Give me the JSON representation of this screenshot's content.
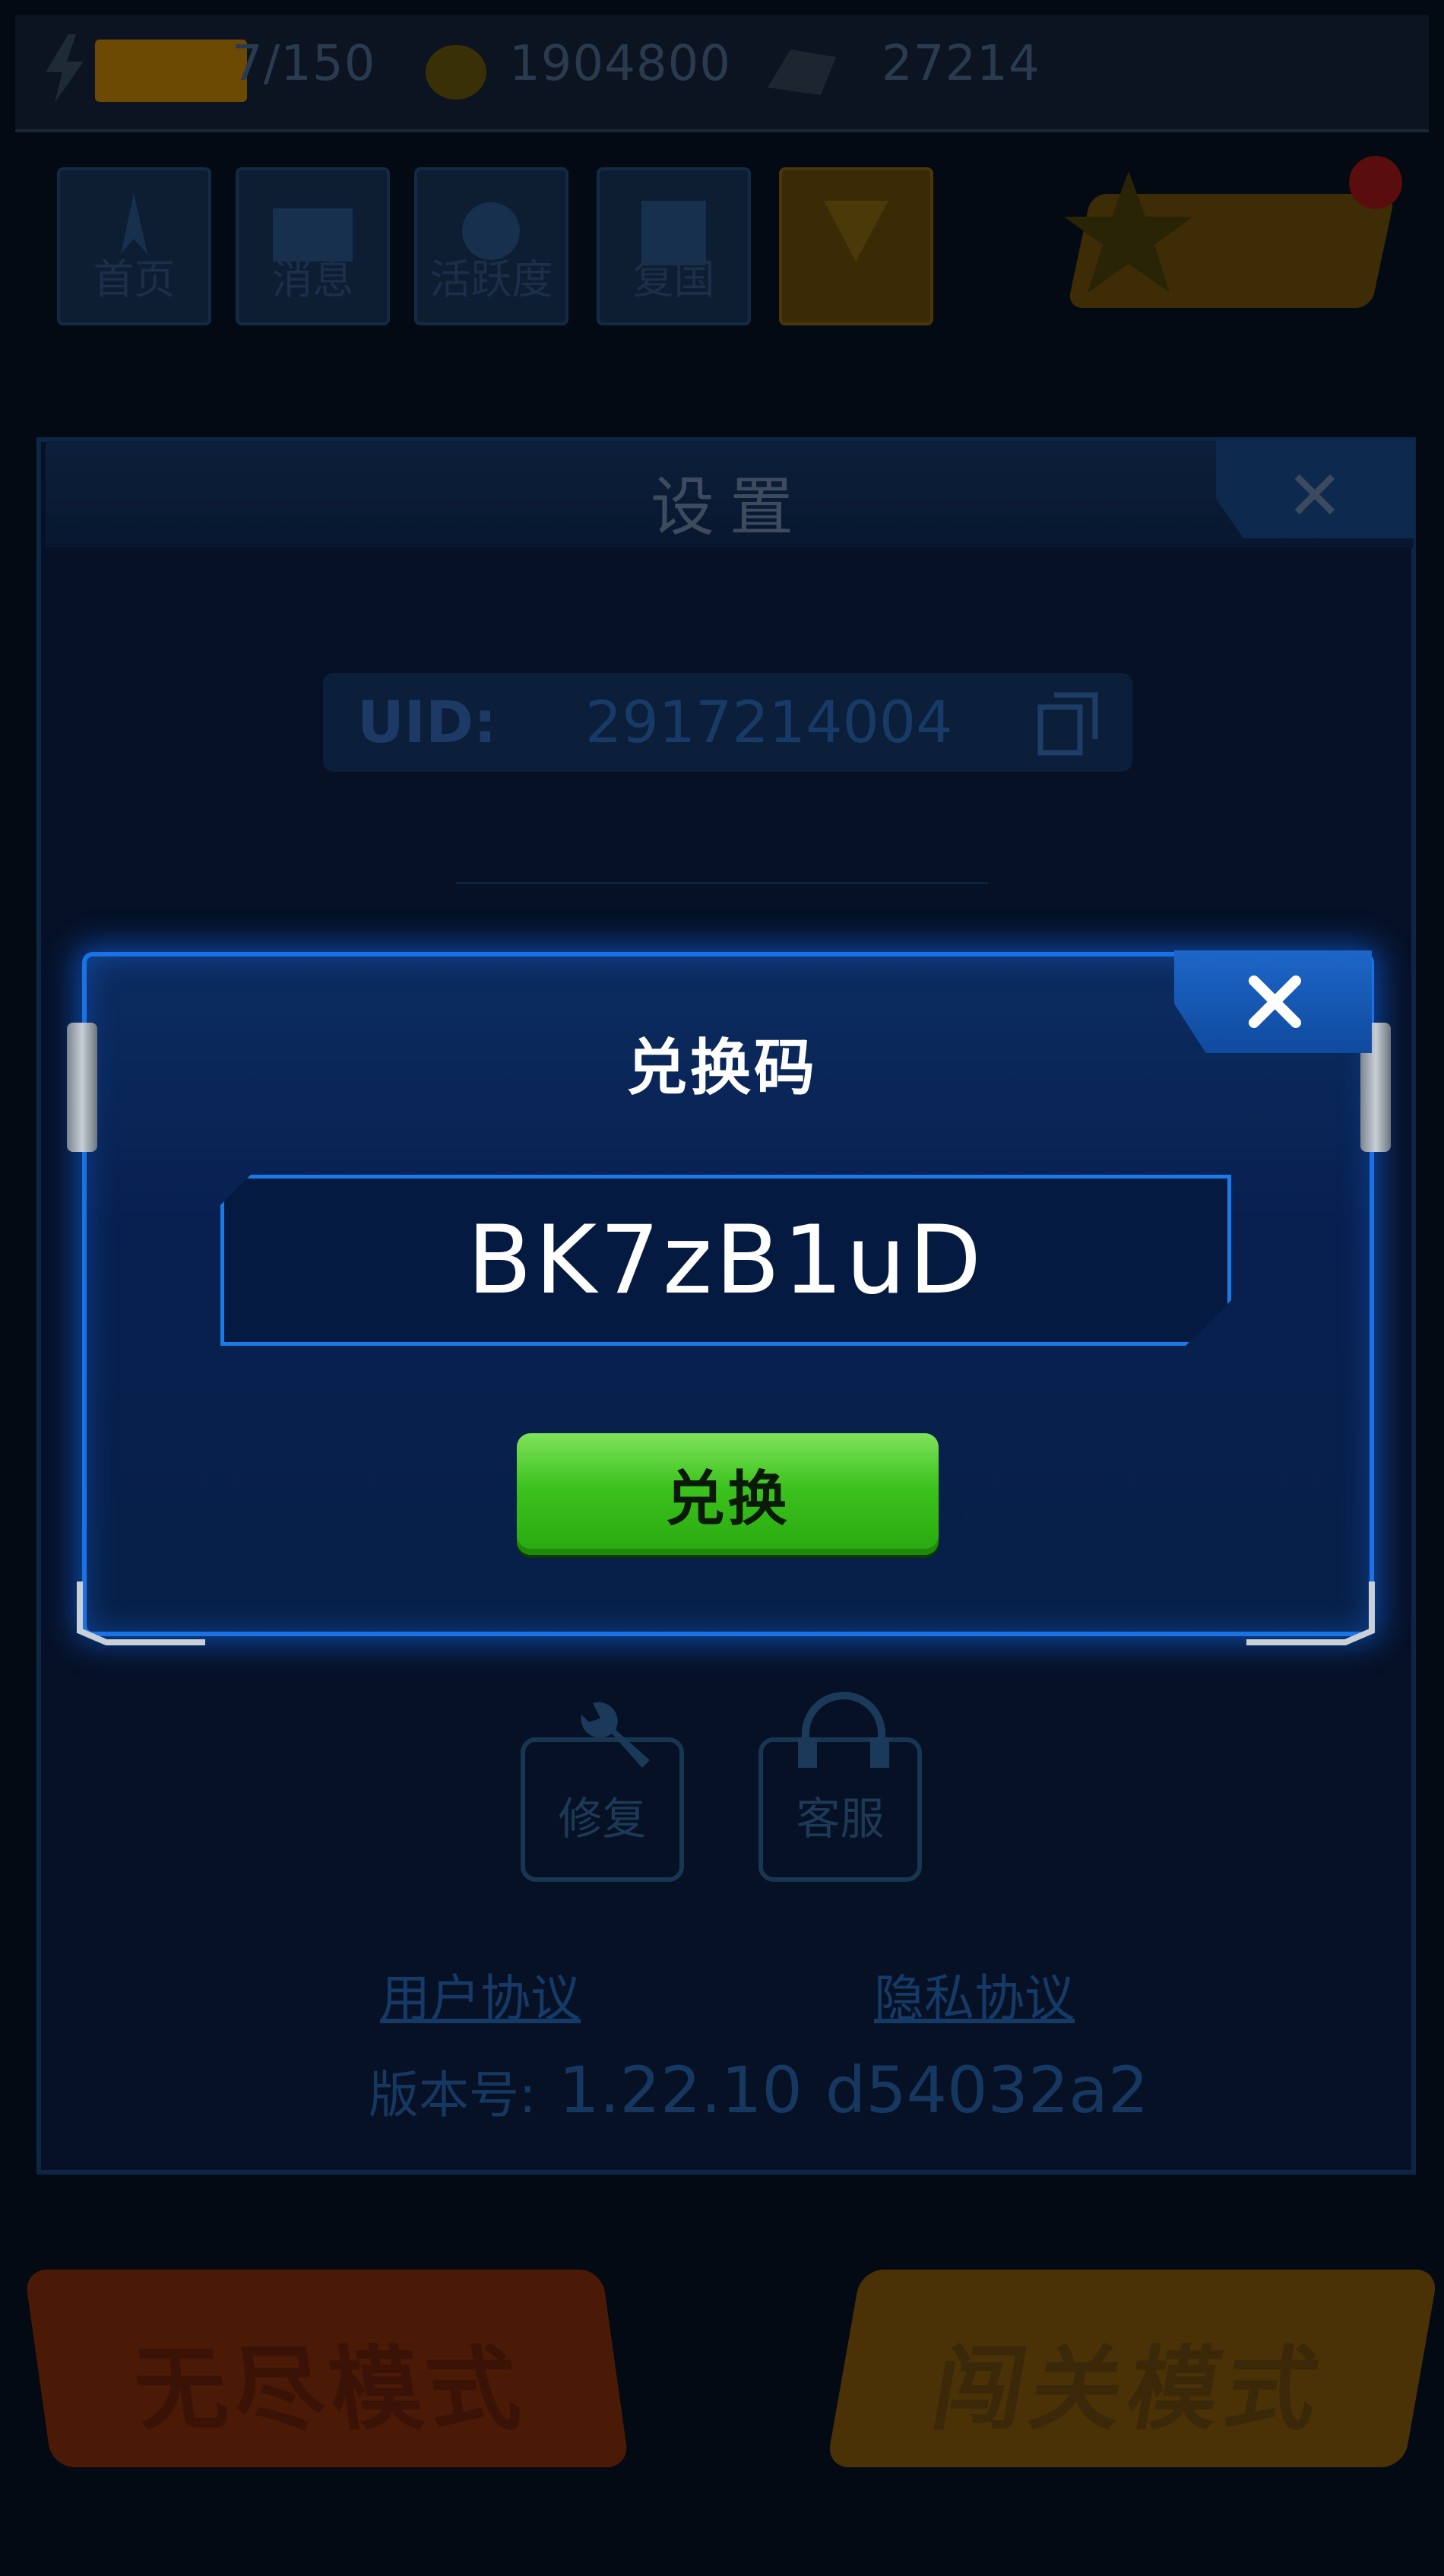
{
  "topbar": {
    "energy": "7/150",
    "gold": "1904800",
    "gems": "27214"
  },
  "tabs": [
    {
      "label": "首页"
    },
    {
      "label": "消息"
    },
    {
      "label": "活跃度"
    },
    {
      "label": "复国"
    },
    {
      "label": ""
    }
  ],
  "settings": {
    "title": "设置",
    "close_symbol": "✕",
    "uid_label": "UID:",
    "uid_value": "2917214004",
    "repair_label": "修复",
    "service_label": "客服",
    "user_agreement": "用户协议",
    "privacy_agreement": "隐私协议",
    "version_label": "版本号:",
    "version_number": "1.22.10",
    "version_hash": "d54032a2"
  },
  "modes": {
    "endless": "无尽模式",
    "stage": "闯关模式"
  },
  "redeem_dialog": {
    "title": "兑换码",
    "code_value": "BK7zB1uD",
    "redeem_button": "兑换"
  },
  "colors": {
    "dialog_border": "#1a73e6",
    "redeem_green": "#3cc21e",
    "background": "#040a14"
  }
}
